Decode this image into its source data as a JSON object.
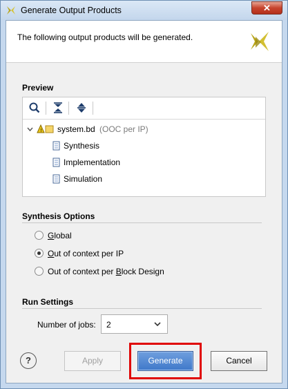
{
  "window": {
    "title": "Generate Output Products",
    "close_label": "✕"
  },
  "header": {
    "message": "The following output products will be generated."
  },
  "preview": {
    "section_label": "Preview",
    "tree": {
      "root_label": "system.bd",
      "root_note": "(OOC per IP)",
      "children": [
        "Synthesis",
        "Implementation",
        "Simulation"
      ]
    }
  },
  "synthesis_options": {
    "section_label": "Synthesis Options",
    "options": [
      {
        "label": "Global",
        "selected": false
      },
      {
        "label": "Out of context per IP",
        "selected": true
      },
      {
        "label": "Out of context per Block Design",
        "selected": false
      }
    ]
  },
  "run_settings": {
    "section_label": "Run Settings",
    "jobs_label": "Number of jobs:",
    "jobs_value": "2"
  },
  "buttons": {
    "help": "?",
    "apply": "Apply",
    "generate": "Generate",
    "cancel": "Cancel"
  },
  "colors": {
    "highlight": "#e00000",
    "primary_button": "#3f78c9",
    "logo": "#c9b31e"
  }
}
